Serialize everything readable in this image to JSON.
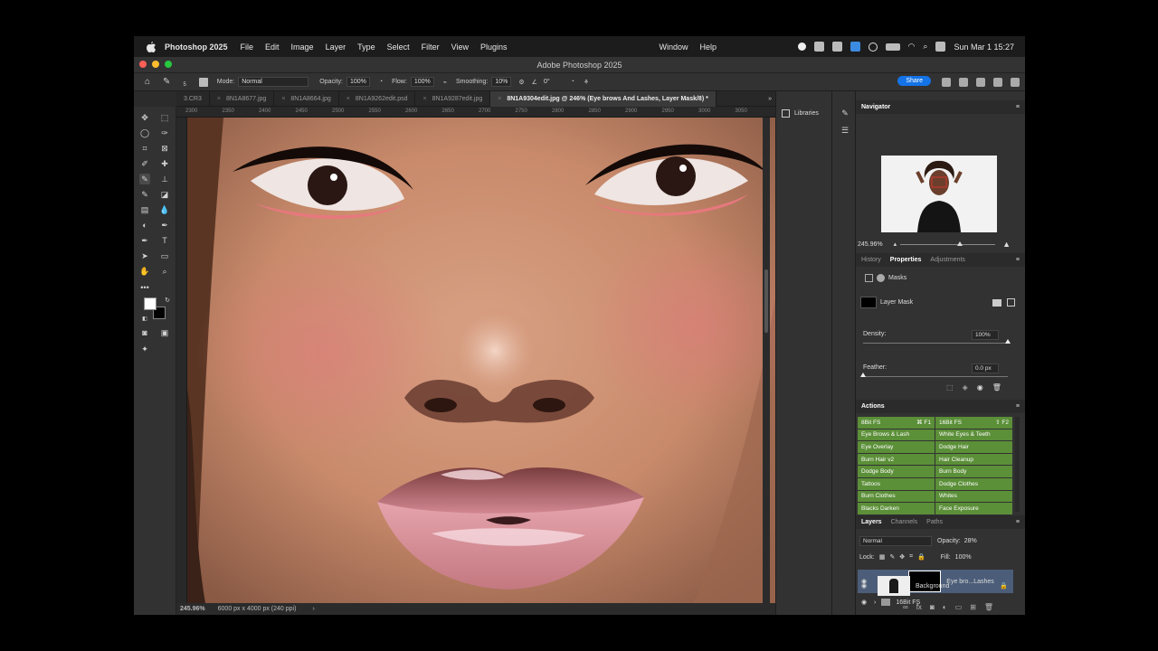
{
  "menubar": {
    "app_name": "Photoshop 2025",
    "items": [
      "File",
      "Edit",
      "Image",
      "Layer",
      "Type",
      "Select",
      "Filter",
      "View",
      "Plugins"
    ],
    "right_items": [
      "Window",
      "Help"
    ],
    "datetime": "Sun Mar 1  15:27"
  },
  "window": {
    "title": "Adobe Photoshop 2025"
  },
  "options": {
    "brush_size": "5",
    "mode_label": "Mode:",
    "mode_value": "Normal",
    "opacity_label": "Opacity:",
    "opacity_value": "100%",
    "flow_label": "Flow:",
    "flow_value": "100%",
    "smoothing_label": "Smoothing:",
    "smoothing_value": "10%",
    "angle_value": "0°",
    "share_label": "Share"
  },
  "tabs": [
    {
      "label": "3.CR3"
    },
    {
      "label": "8N1A8677.jpg"
    },
    {
      "label": "8N1A8664.jpg"
    },
    {
      "label": "8N1A9262edit.psd"
    },
    {
      "label": "8N1A9287edit.jpg"
    },
    {
      "label": "8N1A9304edit.jpg @ 246% (Eye brows And Lashes, Layer Mask/8) *"
    }
  ],
  "ruler_labels": [
    "2300",
    "2350",
    "2400",
    "2450",
    "2500",
    "2550",
    "2600",
    "2650",
    "2700",
    "2750",
    "2800",
    "2850",
    "2900",
    "2950",
    "3000",
    "3050"
  ],
  "status": {
    "zoom": "245.96%",
    "doc_size": "6000 px x 4000 px (240 ppi)",
    "arrow": "›"
  },
  "libraries": {
    "label": "Libraries"
  },
  "navigator": {
    "title": "Navigator",
    "zoom": "245.96%"
  },
  "properties": {
    "tabs": [
      "History",
      "Properties",
      "Adjustments"
    ],
    "active_tab": "Properties",
    "masks_label": "Masks",
    "layer_mask_label": "Layer Mask",
    "density_label": "Density:",
    "density_value": "100%",
    "density_fraction": 1.0,
    "feather_label": "Feather:",
    "feather_value": "0.0 px",
    "feather_fraction": 0.0
  },
  "actions": {
    "title": "Actions",
    "items": [
      {
        "label": "8Bit FS",
        "key": "⌘ F1"
      },
      {
        "label": "16Bit FS",
        "key": "⇧ F2"
      },
      {
        "label": "Eye Brows & Lash",
        "key": ""
      },
      {
        "label": "White Eyes & Teeth",
        "key": ""
      },
      {
        "label": "Eye Overlay",
        "key": ""
      },
      {
        "label": "Dodge Hair",
        "key": ""
      },
      {
        "label": "Burn Hair v2",
        "key": ""
      },
      {
        "label": "Hair Cleanup",
        "key": ""
      },
      {
        "label": "Dodge Body",
        "key": ""
      },
      {
        "label": "Burn Body",
        "key": ""
      },
      {
        "label": "Tattoos",
        "key": ""
      },
      {
        "label": "Dodge Clothes",
        "key": ""
      },
      {
        "label": "Burn Clothes",
        "key": ""
      },
      {
        "label": "Whites",
        "key": ""
      },
      {
        "label": "Blacks Darken",
        "key": ""
      },
      {
        "label": "Face Exposure",
        "key": ""
      }
    ]
  },
  "layers": {
    "tabs": [
      "Layers",
      "Channels",
      "Paths"
    ],
    "blend_mode": "Normal",
    "opacity_label": "Opacity:",
    "opacity_value": "28%",
    "lock_label": "Lock:",
    "fill_label": "Fill:",
    "fill_value": "100%",
    "rows": [
      {
        "name": "Eye bro...Lashes"
      },
      {
        "name": "16Bit FS"
      },
      {
        "name": "Background"
      }
    ]
  },
  "colors": {
    "accent": "#1473e6",
    "action_green": "#5b8f38",
    "selected_layer": "#4b5d78"
  }
}
